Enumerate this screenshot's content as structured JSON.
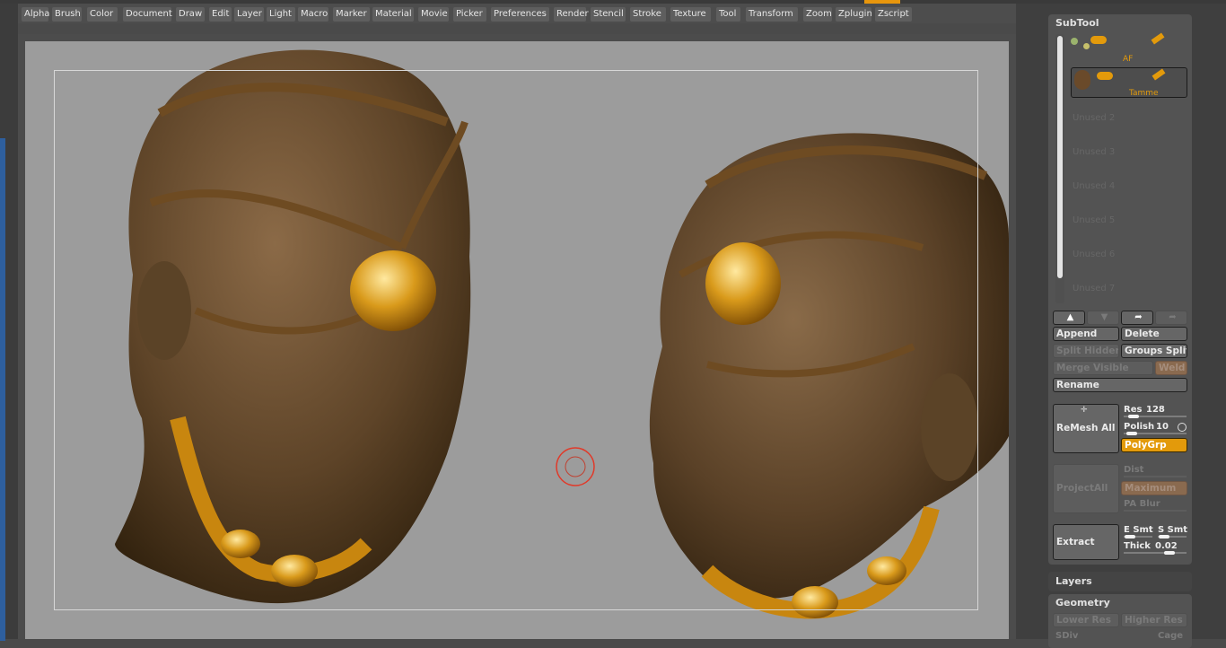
{
  "menu": [
    "Alpha",
    "Brush",
    "Color",
    "Document",
    "Draw",
    "Edit",
    "Layer",
    "Light",
    "Macro",
    "Marker",
    "Material",
    "Movie",
    "Picker",
    "Preferences",
    "Render",
    "Stencil",
    "Stroke",
    "Texture",
    "Tool",
    "Transform",
    "Zoom",
    "Zplugin",
    "Zscript"
  ],
  "subtool": {
    "title": "SubTool",
    "slots": [
      {
        "label": "AF",
        "active": false
      },
      {
        "label": "Tamme",
        "active": true
      },
      {
        "label": "Unused 2"
      },
      {
        "label": "Unused 3"
      },
      {
        "label": "Unused 4"
      },
      {
        "label": "Unused 5"
      },
      {
        "label": "Unused 6"
      },
      {
        "label": "Unused 7"
      }
    ],
    "append": "Append",
    "delete": "Delete",
    "split_hidden": "Split Hidden",
    "groups_split": "Groups Split",
    "merge_visible": "Merge Visible",
    "weld": "Weld",
    "rename": "Rename",
    "remesh_all": "ReMesh All",
    "res_label": "Res",
    "res_value": "128",
    "polish_label": "Polish",
    "polish_value": "10",
    "polygrp": "PolyGrp",
    "project_all": "ProjectAll",
    "dist": "Dist",
    "maximum": "Maximum",
    "pa_blur": "PA Blur",
    "extract": "Extract",
    "e_smt": "E Smt",
    "s_smt": "S Smt",
    "thick_label": "Thick",
    "thick_value": "0.02"
  },
  "layers": {
    "title": "Layers"
  },
  "geometry": {
    "title": "Geometry",
    "lower_res": "Lower Res",
    "higher_res": "Higher Res",
    "sdiv": "SDiv",
    "cage": "Cage"
  },
  "colors": {
    "accent": "#e39a0b",
    "canvas": "#9c9c9c",
    "panel": "#535353"
  }
}
